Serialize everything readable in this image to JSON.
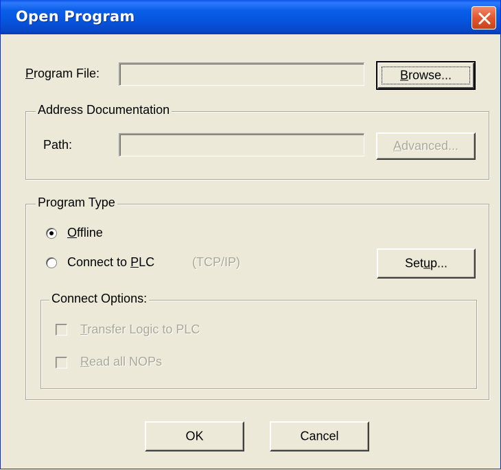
{
  "dialog": {
    "title": "Open Program",
    "close_icon": "close-icon"
  },
  "program_file": {
    "label_prefix": "",
    "label_accel": "P",
    "label_rest": "rogram File:",
    "value": "",
    "browse_accel": "B",
    "browse_rest": "rowse..."
  },
  "address_doc": {
    "legend": "Address Documentation",
    "path_label": "Path:",
    "path_value": "",
    "advanced_accel": "A",
    "advanced_rest": "dvanced..."
  },
  "program_type": {
    "legend": "Program Type",
    "offline_accel": "O",
    "offline_rest": "ffline",
    "offline_selected": true,
    "connect_prefix": "Connect to ",
    "connect_accel": "P",
    "connect_rest": "LC",
    "connect_note": "(TCP/IP)",
    "connect_selected": false,
    "setup_prefix": "Set",
    "setup_accel": "u",
    "setup_rest": "p..."
  },
  "connect_options": {
    "legend": "Connect Options:",
    "transfer_accel": "T",
    "transfer_rest": "ransfer Logic to PLC",
    "transfer_checked": false,
    "read_accel": "R",
    "read_rest": "ead all NOPs",
    "read_checked": false
  },
  "footer": {
    "ok_label": "OK",
    "cancel_label": "Cancel"
  },
  "colors": {
    "titlebar": "#0a5fe8",
    "dialog_bg": "#ece9d8",
    "close_button": "#e2572f",
    "disabled_text": "#aca899"
  }
}
